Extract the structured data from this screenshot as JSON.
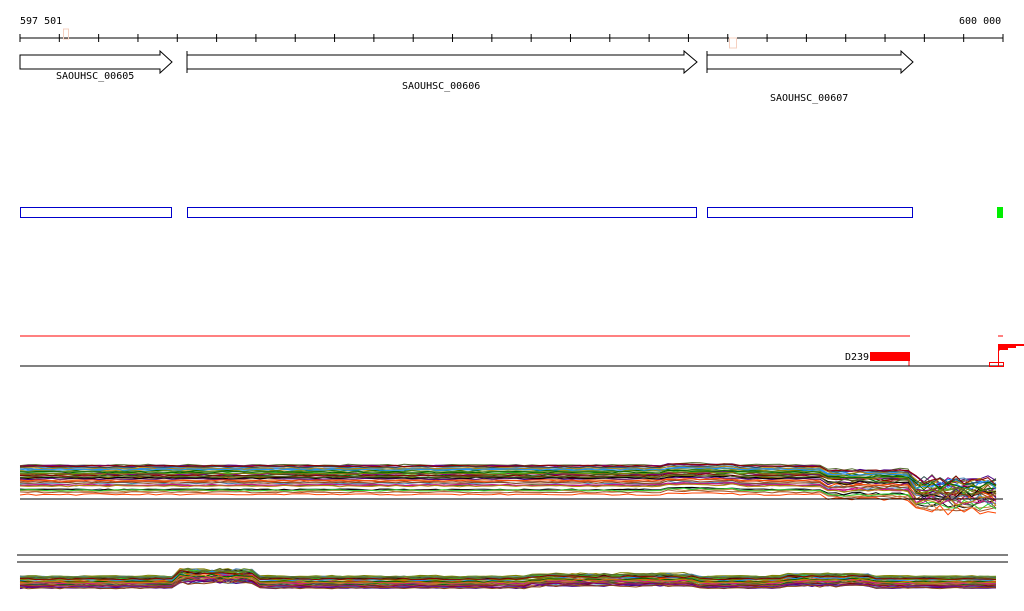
{
  "ruler": {
    "start_label": "597 501",
    "end_label": "600 000",
    "tick_count": 25
  },
  "genes": [
    {
      "name": "SAOUHSC_00605"
    },
    {
      "name": "SAOUHSC_00606"
    },
    {
      "name": "SAOUHSC_00607"
    }
  ],
  "feature_track": {
    "label": "D239",
    "color": "#ff0000"
  },
  "colors": {
    "gene_box": "#0000cc",
    "marker": "#00ee00",
    "accent": "#ff0000"
  },
  "coverage_palette": [
    "#556b2f",
    "#8b0000",
    "#006400",
    "#b8860b",
    "#4b0082",
    "#2f4f4f",
    "#a0522d",
    "#800080",
    "#cd853f",
    "#ff4500",
    "#4682b4",
    "#6b8e23",
    "#8b4513",
    "#000000",
    "#32cd32",
    "#1e90ff",
    "#c71585",
    "#808000"
  ]
}
